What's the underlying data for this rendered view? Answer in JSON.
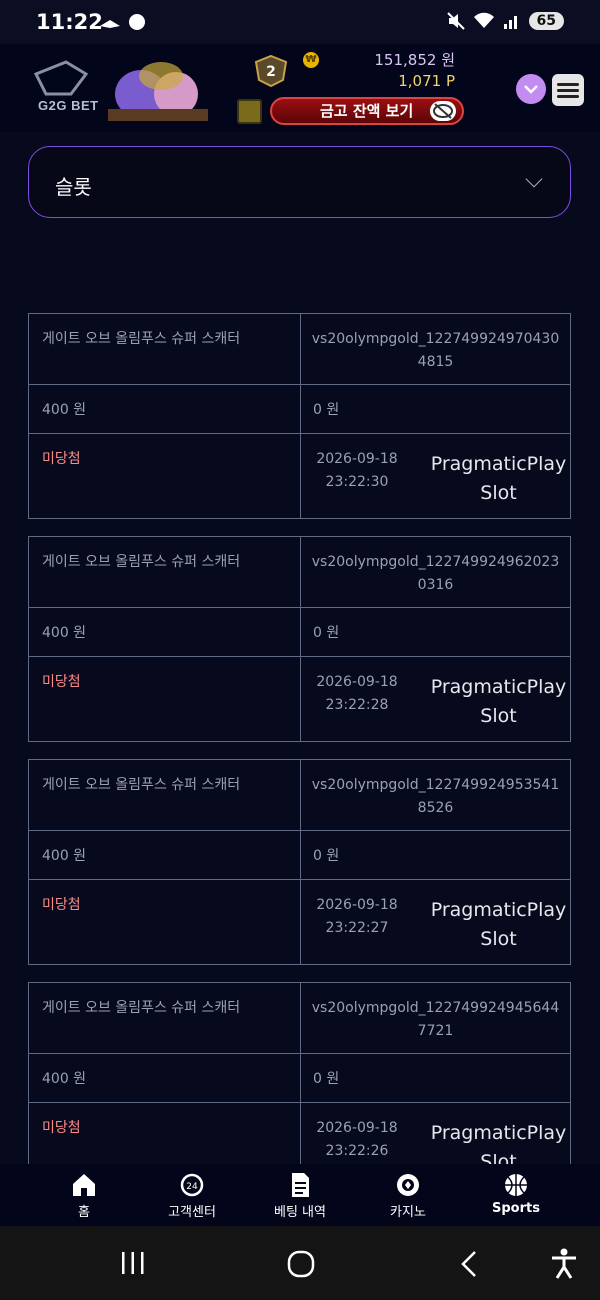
{
  "status_bar": {
    "time": "11:22",
    "battery": "65"
  },
  "header": {
    "logo_text": "G2G BET",
    "level": "2",
    "coin_symbol": "₩",
    "balance_won": "151,852 원",
    "balance_point": "1,071  P",
    "safe_button_label": "금고 잔액 보기"
  },
  "category": {
    "selected": "슬롯"
  },
  "records": [
    {
      "game_name": "게이트 오브 올림푸스 슈퍼 스캐터",
      "game_id": "vs20olympgold_1227499249704304815",
      "bet_amount": "400 원",
      "win_amount": "0 원",
      "result": "미당첨",
      "date": "2026-09-18",
      "time": "23:22:30",
      "provider": "PragmaticPlay Slot"
    },
    {
      "game_name": "게이트 오브 올림푸스 슈퍼 스캐터",
      "game_id": "vs20olympgold_1227499249620230316",
      "bet_amount": "400 원",
      "win_amount": "0 원",
      "result": "미당첨",
      "date": "2026-09-18",
      "time": "23:22:28",
      "provider": "PragmaticPlay Slot"
    },
    {
      "game_name": "게이트 오브 올림푸스 슈퍼 스캐터",
      "game_id": "vs20olympgold_1227499249535418526",
      "bet_amount": "400 원",
      "win_amount": "0 원",
      "result": "미당첨",
      "date": "2026-09-18",
      "time": "23:22:27",
      "provider": "PragmaticPlay Slot"
    },
    {
      "game_name": "게이트 오브 올림푸스 슈퍼 스캐터",
      "game_id": "vs20olympgold_1227499249456447721",
      "bet_amount": "400 원",
      "win_amount": "0 원",
      "result": "미당첨",
      "date": "2026-09-18",
      "time": "23:22:26",
      "provider": "PragmaticPlay Slot"
    }
  ],
  "bottom_nav": [
    {
      "label": "홈",
      "icon": "home-icon"
    },
    {
      "label": "고객센터",
      "icon": "support-24-icon"
    },
    {
      "label": "베팅 내역",
      "icon": "document-icon"
    },
    {
      "label": "카지노",
      "icon": "casino-chip-icon"
    },
    {
      "label": "Sports",
      "icon": "basketball-icon"
    }
  ],
  "colors": {
    "accent": "#7b4de0",
    "lose": "#ff8a8a",
    "point": "#f0d56a",
    "safe_button": "#9a0f12"
  }
}
